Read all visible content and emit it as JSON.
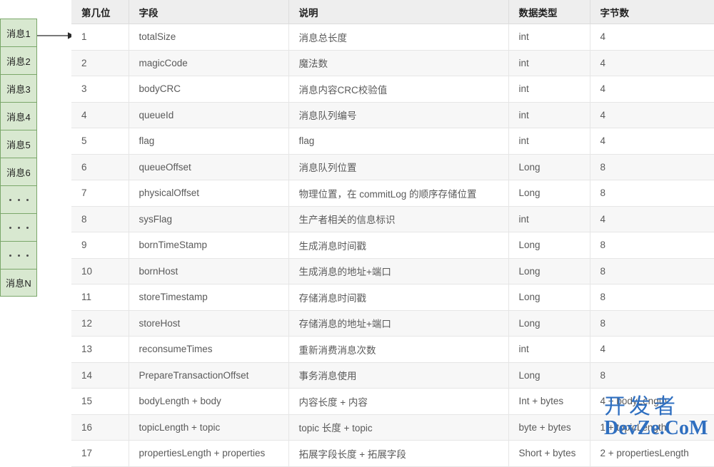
{
  "colors": {
    "queue_fill": "#d8e8d0",
    "queue_border": "#7ba76a",
    "header_bg": "#eeeeee",
    "row_alt_bg": "#f7f7f7",
    "watermark": "#2f6fc0",
    "arrow": "#4d4d4d"
  },
  "queue_diagram": {
    "items": [
      {
        "label": "消息1",
        "type": "text"
      },
      {
        "label": "消息2",
        "type": "text"
      },
      {
        "label": "消息3",
        "type": "text"
      },
      {
        "label": "消息4",
        "type": "text"
      },
      {
        "label": "消息5",
        "type": "text"
      },
      {
        "label": "消息6",
        "type": "text"
      },
      {
        "label": "• • •",
        "type": "dots"
      },
      {
        "label": "• • •",
        "type": "dots"
      },
      {
        "label": "• • •",
        "type": "dots"
      },
      {
        "label": "消息N",
        "type": "text"
      }
    ]
  },
  "table": {
    "headers": [
      "第几位",
      "字段",
      "说明",
      "数据类型",
      "字节数"
    ],
    "rows": [
      [
        "1",
        "totalSize",
        "消息总长度",
        "int",
        "4"
      ],
      [
        "2",
        "magicCode",
        "魔法数",
        "int",
        "4"
      ],
      [
        "3",
        "bodyCRC",
        "消息内容CRC校验值",
        "int",
        "4"
      ],
      [
        "4",
        "queueId",
        "消息队列编号",
        "int",
        "4"
      ],
      [
        "5",
        "flag",
        "flag",
        "int",
        "4"
      ],
      [
        "6",
        "queueOffset",
        "消息队列位置",
        "Long",
        "8"
      ],
      [
        "7",
        "physicalOffset",
        "物理位置，在 commitLog 的顺序存储位置",
        "Long",
        "8"
      ],
      [
        "8",
        "sysFlag",
        "生产者相关的信息标识",
        "int",
        "4"
      ],
      [
        "9",
        "bornTimeStamp",
        "生成消息时间戳",
        "Long",
        "8"
      ],
      [
        "10",
        "bornHost",
        "生成消息的地址+端口",
        "Long",
        "8"
      ],
      [
        "11",
        "storeTimestamp",
        "存储消息时间戳",
        "Long",
        "8"
      ],
      [
        "12",
        "storeHost",
        "存储消息的地址+端口",
        "Long",
        "8"
      ],
      [
        "13",
        "reconsumeTimes",
        "重新消费消息次数",
        "int",
        "4"
      ],
      [
        "14",
        "PrepareTransactionOffset",
        "事务消息使用",
        "Long",
        "8"
      ],
      [
        "15",
        "bodyLength + body",
        "内容长度 + 内容",
        "Int + bytes",
        "4 + bodyLength"
      ],
      [
        "16",
        "topicLength + topic",
        "topic 长度 + topic",
        "byte + bytes",
        "1 + topicLength"
      ],
      [
        "17",
        "propertiesLength + properties",
        "拓展字段长度 + 拓展字段",
        "Short + bytes",
        "2 + propertiesLength"
      ]
    ]
  },
  "watermark": {
    "line1": "开发者",
    "line2": "DevZe.CoM"
  }
}
